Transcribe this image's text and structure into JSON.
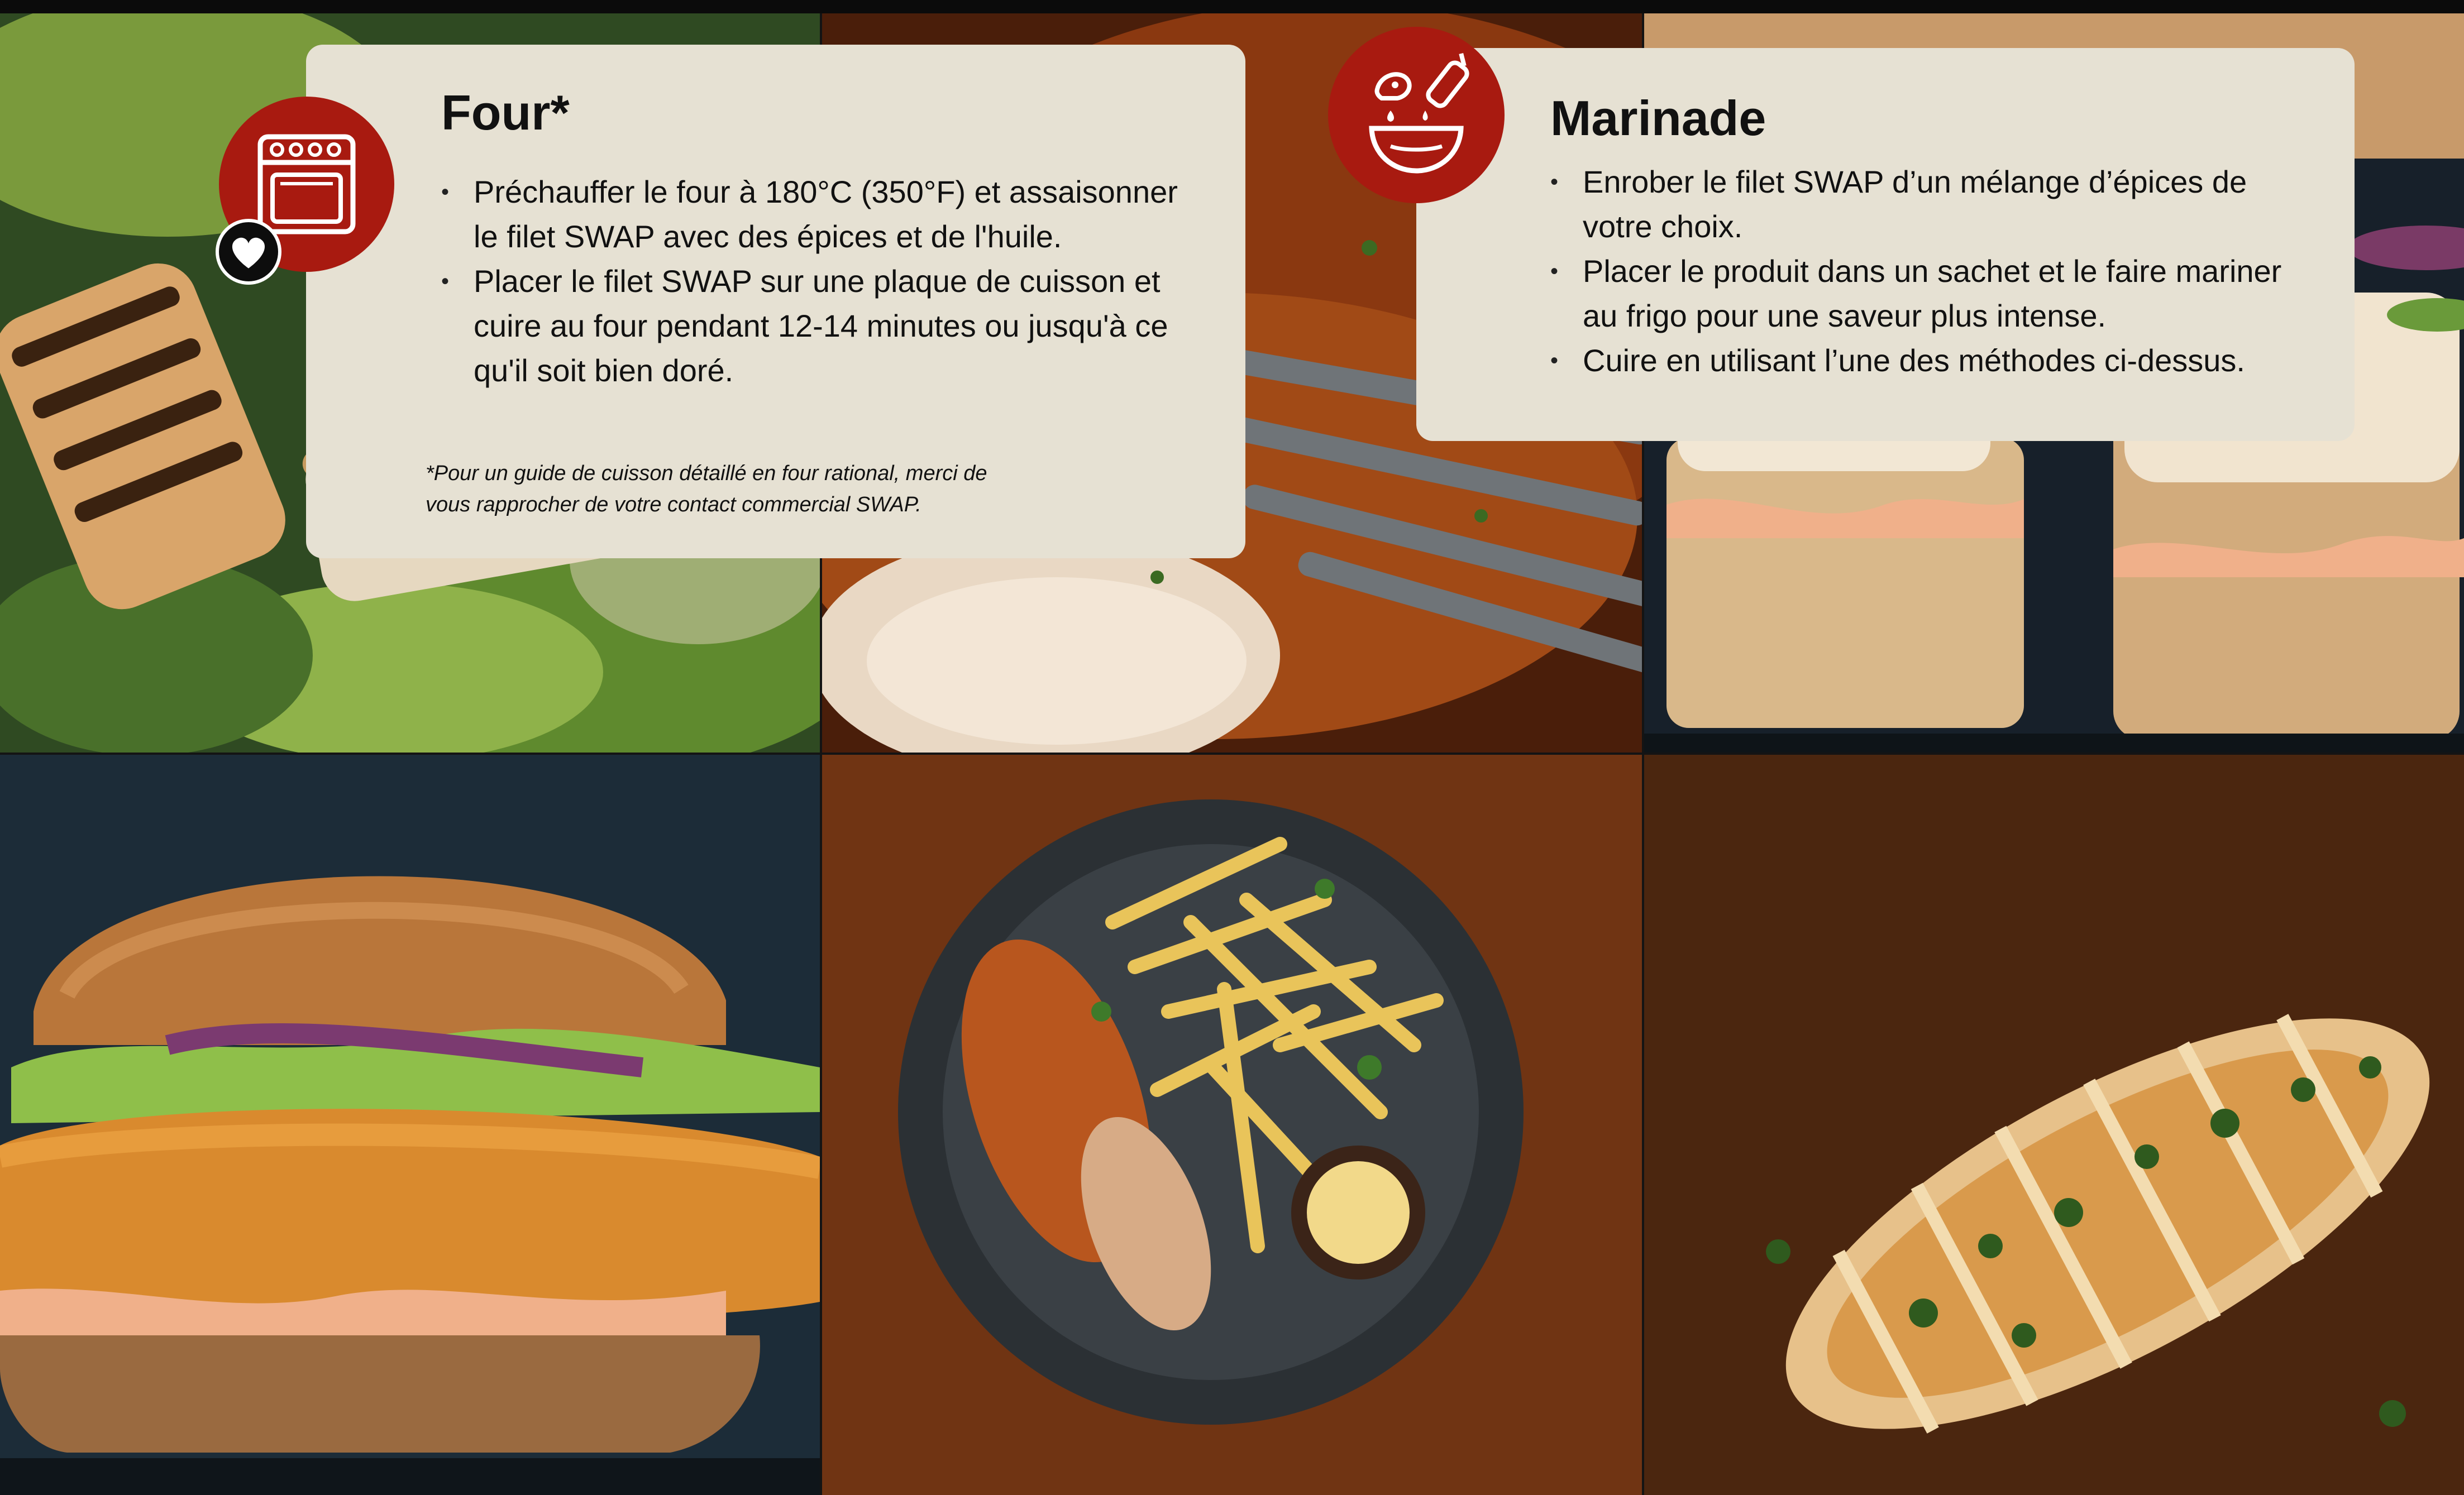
{
  "cards": {
    "four": {
      "title": "Four*",
      "icon": "oven-icon",
      "badge_icon": "heart-icon",
      "items": [
        "Préchauffer le four à 180°C (350°F) et assaisonner le filet SWAP avec des épices et de l'huile.",
        "Placer le filet SWAP sur une plaque de cuisson et cuire au four pendant 12-14 minutes ou jusqu'à ce qu'il soit bien doré."
      ],
      "note": "*Pour un guide de cuisson détaillé en four rational, merci de\nvous rapprocher de votre contact commercial SWAP."
    },
    "marinade": {
      "title": "Marinade",
      "icon": "marinade-bowl-icon",
      "items": [
        "Enrober le filet SWAP d’un mélange d’épices de votre choix.",
        "Placer le produit dans un sachet et le faire mariner au frigo pour une saveur plus intense.",
        "Cuire en utilisant l’une des méthodes ci-dessus."
      ]
    }
  },
  "photos": [
    "caesar-salad-grilled-chicken-photo",
    "glazed-chicken-with-fork-photo",
    "chicken-sandwich-with-sauce-photo",
    "crispy-chicken-burger-photo",
    "chicken-and-fries-plate-photo",
    "herb-grilled-chicken-fillet-photo"
  ],
  "colors": {
    "card_background": "#e6e1d3",
    "badge_red": "#a81a10",
    "text": "#111111"
  }
}
